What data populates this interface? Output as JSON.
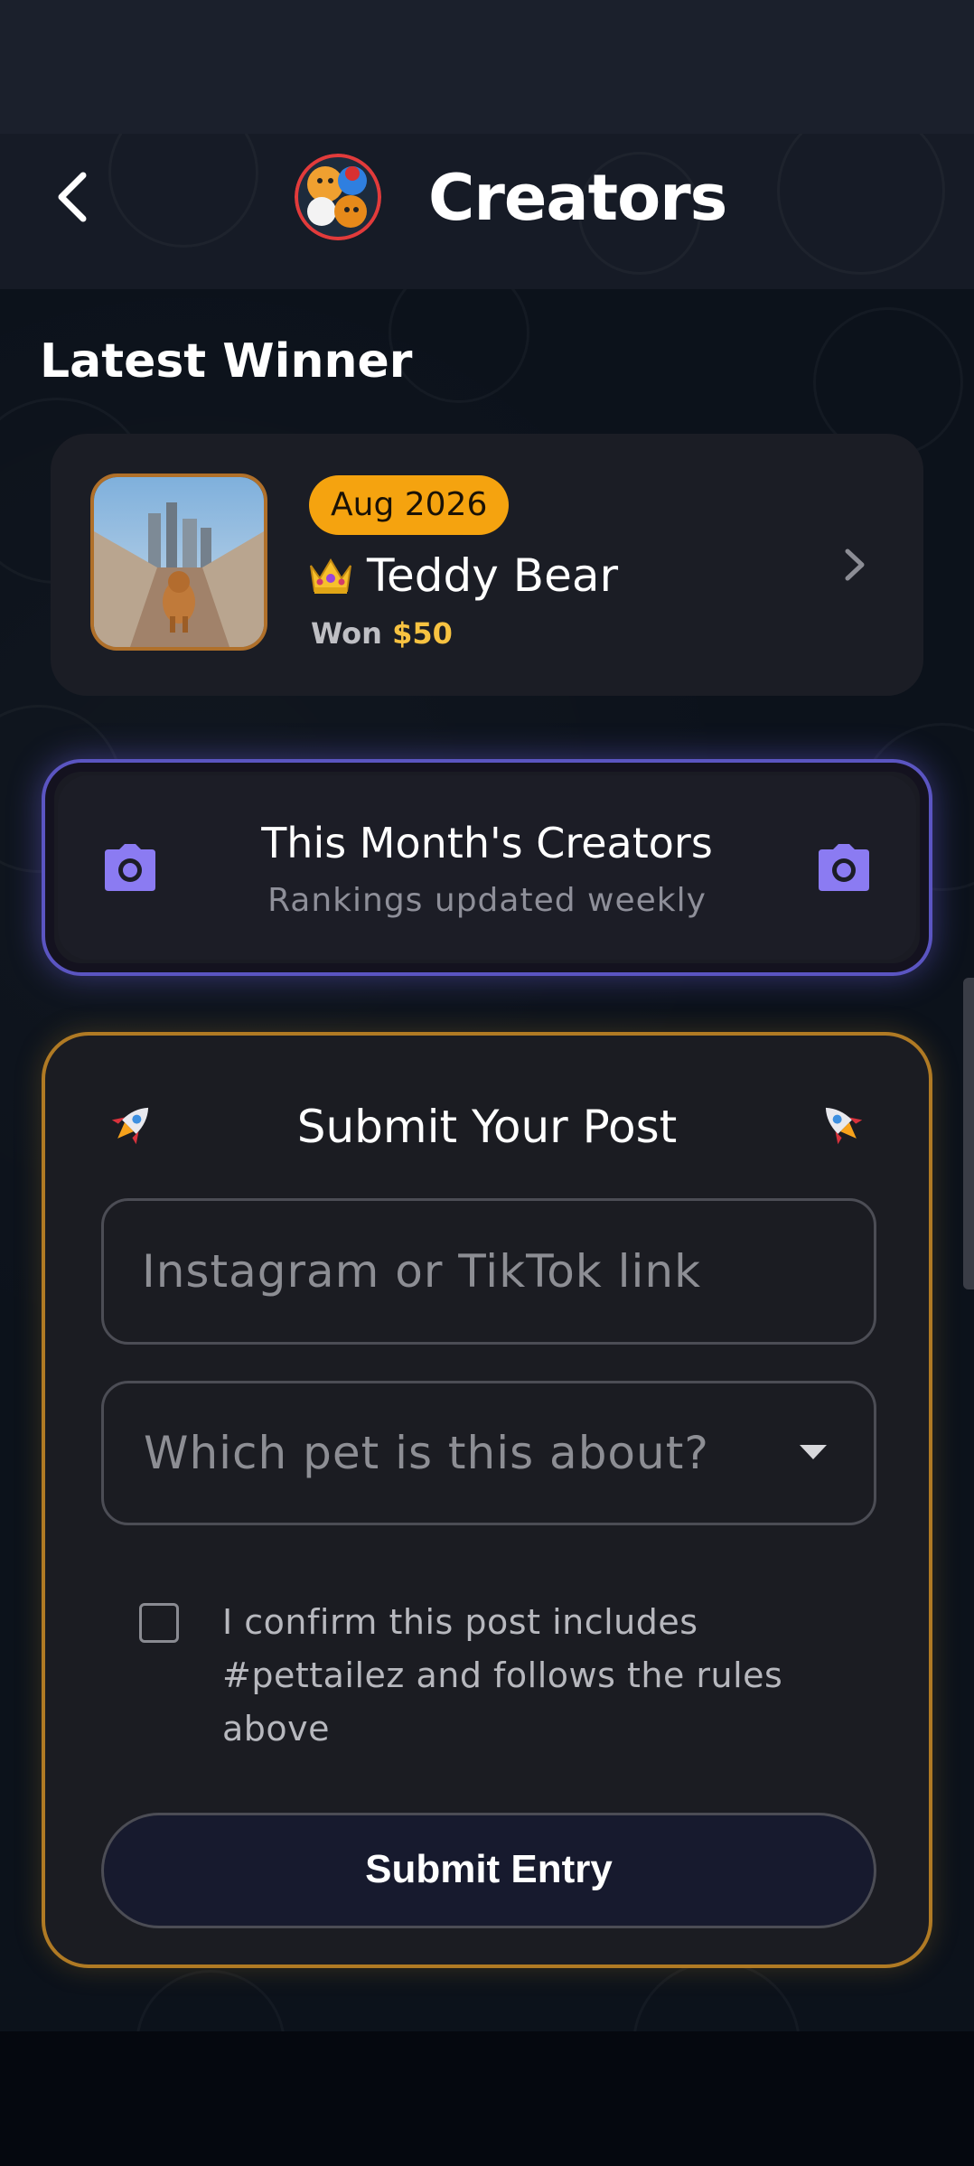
{
  "header": {
    "title": "Creators",
    "back_icon": "chevron-left-icon",
    "logo_icon": "pet-characters-logo-icon"
  },
  "latest_winner": {
    "section_title": "Latest Winner",
    "month": "Aug 2026",
    "crown": "👑",
    "name": "Teddy Bear",
    "won_prefix": "Won",
    "won_amount": "$50",
    "photo": "bulldog-on-boardwalk-photo",
    "chevron_icon": "chevron-right-icon"
  },
  "creators_banner": {
    "title": "This Month's Creators",
    "subtitle": "Rankings updated weekly",
    "icon": "camera-icon",
    "accent": "#8b7bf2"
  },
  "submit": {
    "rocket": "rocket-icon",
    "title": "Submit Your Post",
    "link_placeholder": "Instagram or TikTok link",
    "pet_select_placeholder": "Which pet is this about?",
    "confirm_text": "I confirm this post includes #pettailez and follows the rules above",
    "button_label": "Submit Entry",
    "border_color": "#b07a24"
  }
}
